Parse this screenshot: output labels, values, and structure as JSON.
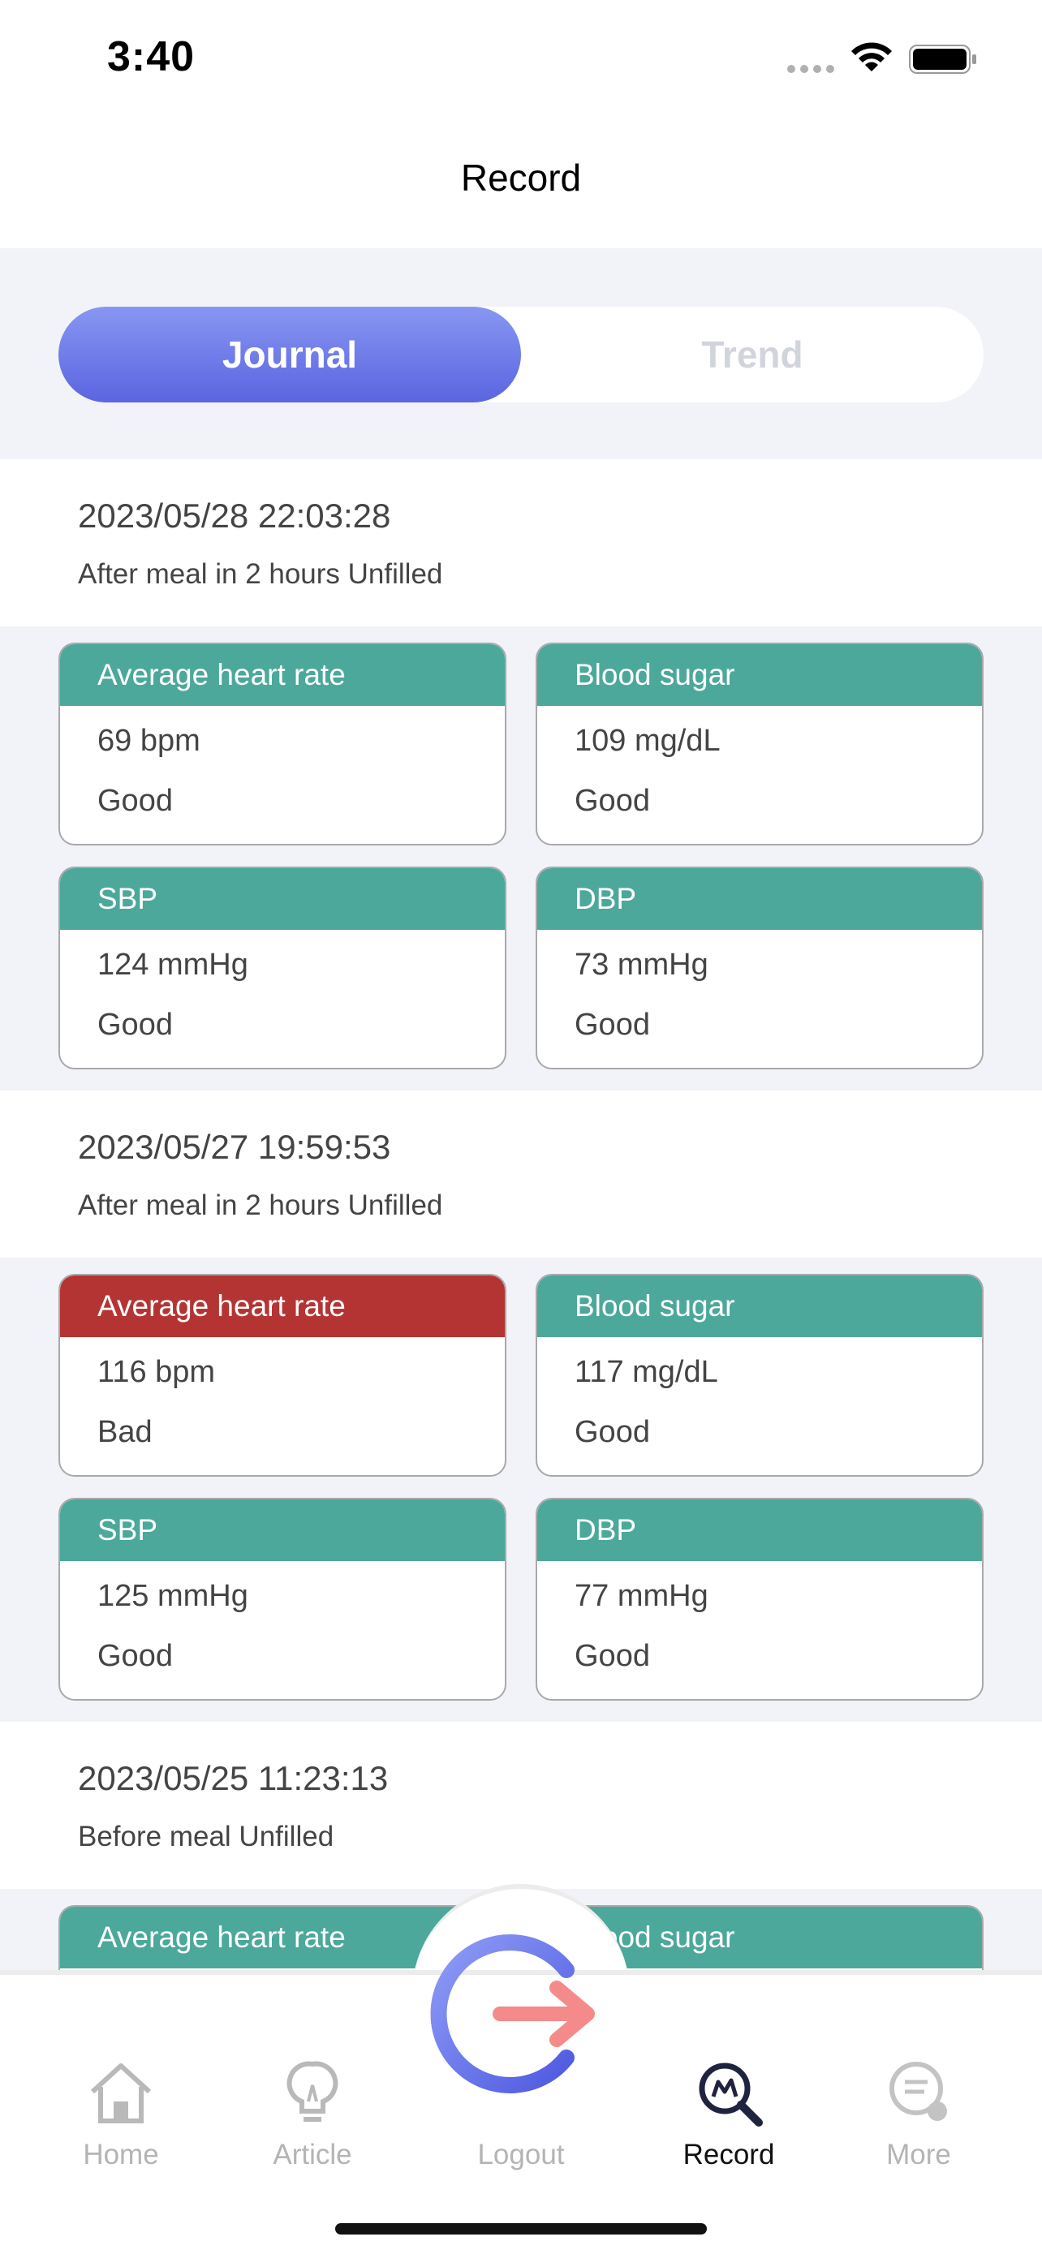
{
  "status_bar": {
    "time": "3:40"
  },
  "nav": {
    "title": "Record"
  },
  "segment": {
    "journal": "Journal",
    "trend": "Trend"
  },
  "records": [
    {
      "datetime": "2023/05/28 22:03:28",
      "note": "After meal in 2 hours  Unfilled",
      "cards": [
        {
          "title": "Average heart rate",
          "value": "69 bpm",
          "status": "Good"
        },
        {
          "title": "Blood sugar",
          "value": "109 mg/dL",
          "status": "Good"
        },
        {
          "title": "SBP",
          "value": "124 mmHg",
          "status": "Good"
        },
        {
          "title": "DBP",
          "value": "73 mmHg",
          "status": "Good"
        }
      ]
    },
    {
      "datetime": "2023/05/27 19:59:53",
      "note": "After meal in 2 hours  Unfilled",
      "cards": [
        {
          "title": "Average heart rate",
          "value": "116 bpm",
          "status": "Bad"
        },
        {
          "title": "Blood sugar",
          "value": "117 mg/dL",
          "status": "Good"
        },
        {
          "title": "SBP",
          "value": "125 mmHg",
          "status": "Good"
        },
        {
          "title": "DBP",
          "value": "77 mmHg",
          "status": "Good"
        }
      ]
    },
    {
      "datetime": "2023/05/25 11:23:13",
      "note": "Before meal  Unfilled",
      "cards": [
        {
          "title": "Average heart rate"
        },
        {
          "title": "Blood sugar"
        }
      ]
    }
  ],
  "tabs": [
    {
      "label": "Home",
      "icon": "home-icon"
    },
    {
      "label": "Article",
      "icon": "lightbulb-icon"
    },
    {
      "label": "Logout",
      "icon": "logout-icon"
    },
    {
      "label": "Record",
      "icon": "record-search-icon"
    },
    {
      "label": "More",
      "icon": "more-icon"
    }
  ],
  "colors": {
    "accent": "#5a65e0",
    "good_header": "#4ba89b",
    "bad_header": "#b43434",
    "background": "#f2f3f9"
  }
}
